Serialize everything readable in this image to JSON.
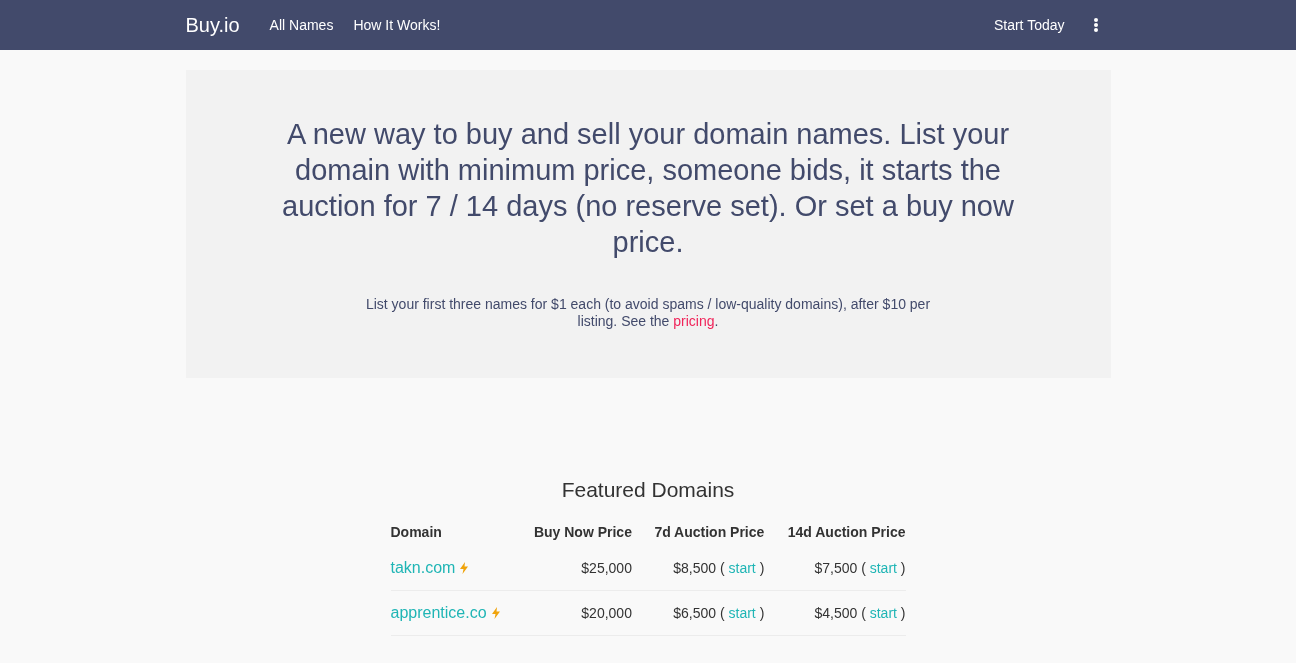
{
  "navbar": {
    "brand": "Buy.io",
    "links": [
      "All Names",
      "How It Works!"
    ],
    "cta": "Start Today"
  },
  "hero": {
    "headline": "A new way to buy and sell your domain names. List your domain with minimum price, someone bids, it starts the auction for 7 / 14 days (no reserve set). Or set a buy now price.",
    "note": "List your first three names for $1 each (to avoid spams / low-quality domains), after $10 per listing. See the",
    "link": "pricing",
    "after_link": "."
  },
  "featured": {
    "title": "Featured Domains",
    "columns": [
      "Domain",
      "Buy Now Price",
      "7d Auction Price",
      "14d Auction Price"
    ],
    "rows": [
      {
        "domain": "takn.com",
        "featured": true,
        "buy_now": "$25,000",
        "auctions": [
          {
            "price": "$8,500",
            "open": "(",
            "action": "start",
            "close": ")"
          },
          {
            "price": "$7,500",
            "open": "(",
            "action": "start",
            "close": ")"
          }
        ]
      },
      {
        "domain": "apprentice.co",
        "featured": true,
        "buy_now": "$20,000",
        "auctions": [
          {
            "price": "$6,500",
            "open": "(",
            "action": "start",
            "close": ")"
          },
          {
            "price": "$4,500",
            "open": "(",
            "action": "start",
            "close": ")"
          }
        ]
      }
    ]
  }
}
